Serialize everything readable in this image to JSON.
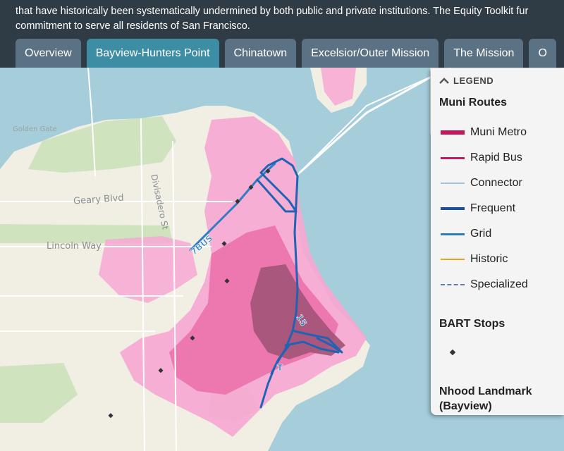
{
  "intro": {
    "line1": "that have historically been systematically undermined by both public and private institutions. The Equity Toolkit fur",
    "line2": "commitment to serve all residents of San Francisco."
  },
  "tabs": [
    {
      "label": "Overview",
      "active": false
    },
    {
      "label": "Bayview-Hunters Point",
      "active": true
    },
    {
      "label": "Chinatown",
      "active": false
    },
    {
      "label": "Excelsior/Outer Mission",
      "active": false
    },
    {
      "label": "The Mission",
      "active": false
    },
    {
      "label": "O",
      "active": false
    }
  ],
  "map": {
    "labels": {
      "golden_gate": "Golden Gate",
      "geary": "Geary Blvd",
      "lincoln": "Lincoln Way",
      "divisadero": "Divisadero St",
      "route_7bus": "7BUS",
      "route_15": "15",
      "route_t": "T"
    }
  },
  "legend": {
    "toggle_label": "LEGEND",
    "muni_title": "Muni Routes",
    "items": [
      {
        "label": "Muni Metro",
        "color": "#c2185b",
        "style": "thick"
      },
      {
        "label": "Rapid Bus",
        "color": "#c2185b",
        "style": "solid"
      },
      {
        "label": "Connector",
        "color": "#9ec3dc",
        "style": "solid"
      },
      {
        "label": "Frequent",
        "color": "#1f4f96",
        "style": "solid"
      },
      {
        "label": "Grid",
        "color": "#2f7cc1",
        "style": "solid"
      },
      {
        "label": "Historic",
        "color": "#e8a317",
        "style": "solid"
      },
      {
        "label": "Specialized",
        "color": "#5b7fa6",
        "style": "dashed"
      }
    ],
    "bart_title": "BART Stops",
    "landmark_title": "Nhood Landmark",
    "landmark_sub": "(Bayview)"
  }
}
